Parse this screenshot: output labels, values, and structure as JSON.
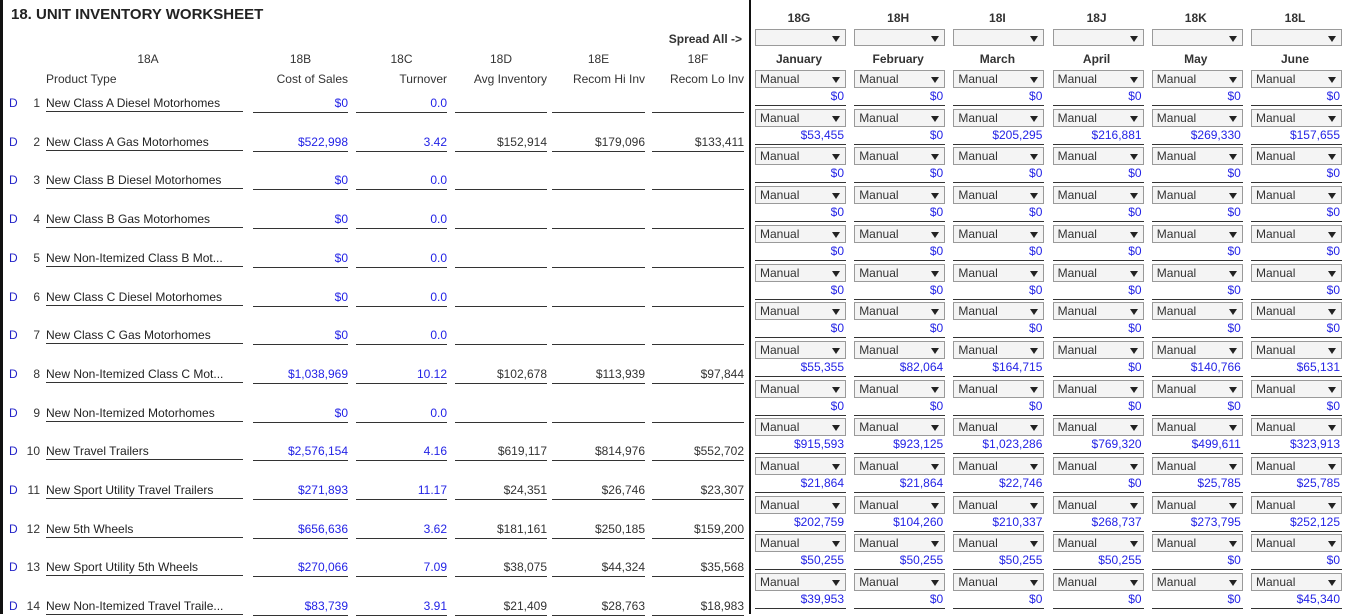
{
  "title": "18. UNIT INVENTORY WORKSHEET",
  "spread_all": "Spread All ->",
  "columns": {
    "a": {
      "code": "18A",
      "label": "Product Type"
    },
    "b": {
      "code": "18B",
      "label": "Cost of Sales"
    },
    "c": {
      "code": "18C",
      "label": "Turnover"
    },
    "d": {
      "code": "18D",
      "label": "Avg Inventory"
    },
    "e": {
      "code": "18E",
      "label": "Recom Hi Inv"
    },
    "f": {
      "code": "18F",
      "label": "Recom Lo Inv"
    }
  },
  "months": [
    {
      "code": "18G",
      "name": "January"
    },
    {
      "code": "18H",
      "name": "February"
    },
    {
      "code": "18I",
      "name": "March"
    },
    {
      "code": "18J",
      "name": "April"
    },
    {
      "code": "18K",
      "name": "May"
    },
    {
      "code": "18L",
      "name": "June"
    }
  ],
  "select_value": "Manual",
  "flag": "D",
  "rows": [
    {
      "num": "1",
      "name": "New Class A Diesel Motorhomes",
      "cost": "$0",
      "turnover": "0.0",
      "avg": "",
      "hi": "",
      "lo": "",
      "monthly": [
        "$0",
        "$0",
        "$0",
        "$0",
        "$0",
        "$0"
      ]
    },
    {
      "num": "2",
      "name": "New Class A Gas Motorhomes",
      "cost": "$522,998",
      "turnover": "3.42",
      "avg": "$152,914",
      "hi": "$179,096",
      "lo": "$133,411",
      "monthly": [
        "$53,455",
        "$0",
        "$205,295",
        "$216,881",
        "$269,330",
        "$157,655"
      ]
    },
    {
      "num": "3",
      "name": "New Class B Diesel Motorhomes",
      "cost": "$0",
      "turnover": "0.0",
      "avg": "",
      "hi": "",
      "lo": "",
      "monthly": [
        "$0",
        "$0",
        "$0",
        "$0",
        "$0",
        "$0"
      ]
    },
    {
      "num": "4",
      "name": "New Class B Gas Motorhomes",
      "cost": "$0",
      "turnover": "0.0",
      "avg": "",
      "hi": "",
      "lo": "",
      "monthly": [
        "$0",
        "$0",
        "$0",
        "$0",
        "$0",
        "$0"
      ]
    },
    {
      "num": "5",
      "name": "New Non-Itemized Class B Mot...",
      "cost": "$0",
      "turnover": "0.0",
      "avg": "",
      "hi": "",
      "lo": "",
      "monthly": [
        "$0",
        "$0",
        "$0",
        "$0",
        "$0",
        "$0"
      ]
    },
    {
      "num": "6",
      "name": "New Class C Diesel Motorhomes",
      "cost": "$0",
      "turnover": "0.0",
      "avg": "",
      "hi": "",
      "lo": "",
      "monthly": [
        "$0",
        "$0",
        "$0",
        "$0",
        "$0",
        "$0"
      ]
    },
    {
      "num": "7",
      "name": "New Class C Gas Motorhomes",
      "cost": "$0",
      "turnover": "0.0",
      "avg": "",
      "hi": "",
      "lo": "",
      "monthly": [
        "$0",
        "$0",
        "$0",
        "$0",
        "$0",
        "$0"
      ]
    },
    {
      "num": "8",
      "name": "New Non-Itemized Class C Mot...",
      "cost": "$1,038,969",
      "turnover": "10.12",
      "avg": "$102,678",
      "hi": "$113,939",
      "lo": "$97,844",
      "monthly": [
        "$55,355",
        "$82,064",
        "$164,715",
        "$0",
        "$140,766",
        "$65,131"
      ]
    },
    {
      "num": "9",
      "name": "New Non-Itemized Motorhomes",
      "cost": "$0",
      "turnover": "0.0",
      "avg": "",
      "hi": "",
      "lo": "",
      "monthly": [
        "$0",
        "$0",
        "$0",
        "$0",
        "$0",
        "$0"
      ]
    },
    {
      "num": "10",
      "name": "New Travel Trailers",
      "cost": "$2,576,154",
      "turnover": "4.16",
      "avg": "$619,117",
      "hi": "$814,976",
      "lo": "$552,702",
      "monthly": [
        "$915,593",
        "$923,125",
        "$1,023,286",
        "$769,320",
        "$499,611",
        "$323,913"
      ]
    },
    {
      "num": "11",
      "name": "New Sport Utility Travel Trailers",
      "cost": "$271,893",
      "turnover": "11.17",
      "avg": "$24,351",
      "hi": "$26,746",
      "lo": "$23,307",
      "monthly": [
        "$21,864",
        "$21,864",
        "$22,746",
        "$0",
        "$25,785",
        "$25,785"
      ]
    },
    {
      "num": "12",
      "name": "New 5th Wheels",
      "cost": "$656,636",
      "turnover": "3.62",
      "avg": "$181,161",
      "hi": "$250,185",
      "lo": "$159,200",
      "monthly": [
        "$202,759",
        "$104,260",
        "$210,337",
        "$268,737",
        "$273,795",
        "$252,125"
      ]
    },
    {
      "num": "13",
      "name": "New Sport Utility 5th Wheels",
      "cost": "$270,066",
      "turnover": "7.09",
      "avg": "$38,075",
      "hi": "$44,324",
      "lo": "$35,568",
      "monthly": [
        "$50,255",
        "$50,255",
        "$50,255",
        "$50,255",
        "$0",
        "$0"
      ]
    },
    {
      "num": "14",
      "name": "New Non-Itemized Travel Traile...",
      "cost": "$83,739",
      "turnover": "3.91",
      "avg": "$21,409",
      "hi": "$28,763",
      "lo": "$18,983",
      "monthly": [
        "$39,953",
        "$0",
        "$0",
        "$0",
        "$0",
        "$45,340"
      ]
    }
  ]
}
